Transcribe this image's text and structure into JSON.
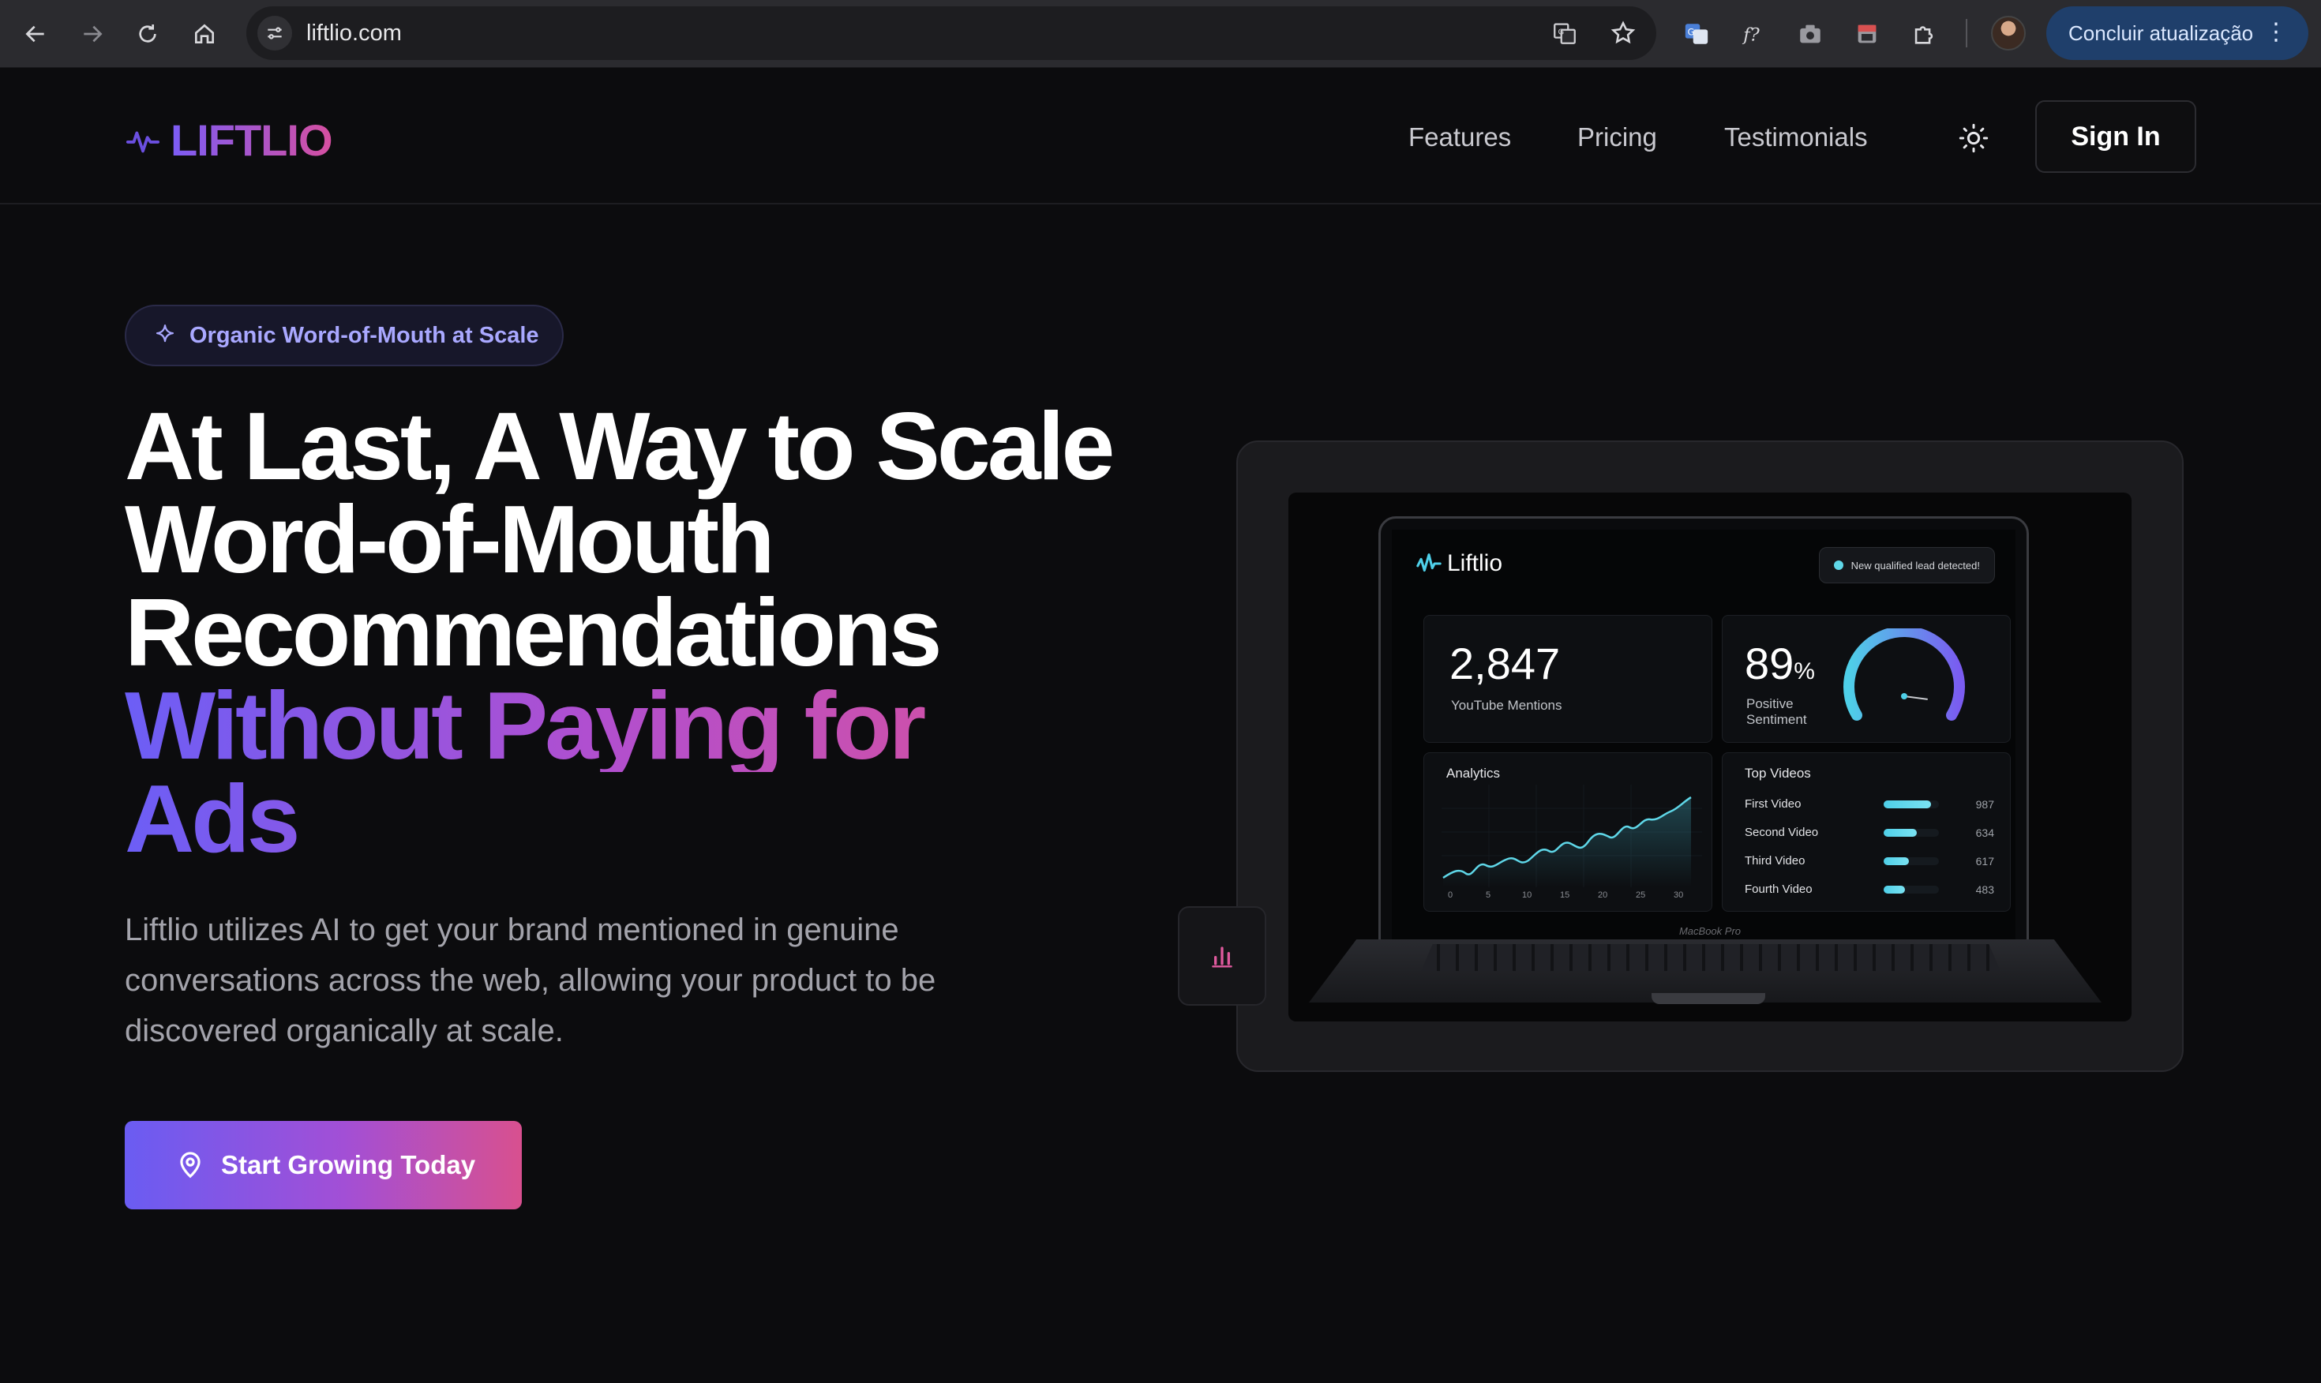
{
  "browser": {
    "url": "liftlio.com",
    "update_label": "Concluir atualização"
  },
  "header": {
    "logo": "LIFTLIO",
    "nav": [
      "Features",
      "Pricing",
      "Testimonials"
    ],
    "signin_label": "Sign In"
  },
  "hero": {
    "badge": "Organic Word-of-Mouth at Scale",
    "headline_white": [
      "At Last, A Way to Scale",
      "Word-of-Mouth",
      "Recommendations"
    ],
    "headline_gradient": [
      "Without Paying for",
      "Ads"
    ],
    "subtext": "Liftlio utilizes AI to get your brand mentioned in genuine conversations across the web, allowing your product to be discovered organically at scale.",
    "cta_label": "Start Growing Today"
  },
  "dashboard": {
    "app_name": "Liftlio",
    "lead_badge": "New qualified lead detected!",
    "mentions_value": "2,847",
    "mentions_label": "YouTube Mentions",
    "sentiment_value": "89",
    "sentiment_unit": "%",
    "sentiment_label_1": "Positive",
    "sentiment_label_2": "Sentiment",
    "sentiment_gauge_fraction": 0.89,
    "analytics_title": "Analytics",
    "analytics_x_ticks": [
      "0",
      "5",
      "10",
      "15",
      "20",
      "25",
      "30"
    ],
    "top_videos_title": "Top Videos",
    "top_videos": [
      {
        "name": "First Video",
        "value": "987",
        "fraction": 0.85
      },
      {
        "name": "Second Video",
        "value": "634",
        "fraction": 0.6
      },
      {
        "name": "Third Video",
        "value": "617",
        "fraction": 0.45
      },
      {
        "name": "Fourth Video",
        "value": "483",
        "fraction": 0.38
      }
    ],
    "laptop_label": "MacBook Pro"
  },
  "colors": {
    "accent_purple": "#6a5cf2",
    "accent_pink": "#d8508f",
    "accent_cyan": "#4ecfe8",
    "update_button": "#1f3f6b"
  }
}
